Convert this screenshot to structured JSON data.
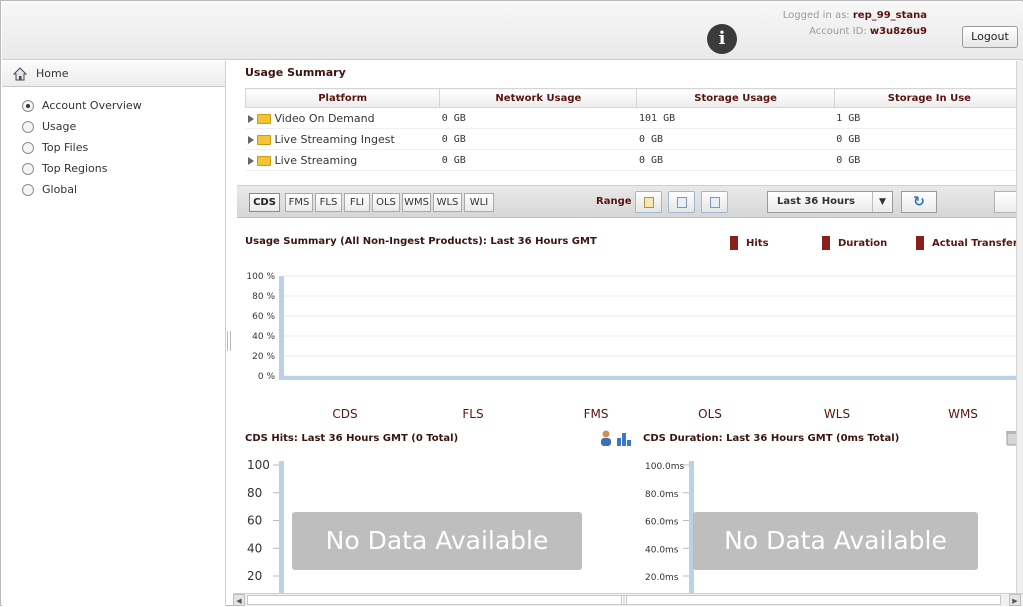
{
  "header": {
    "logged_in_prefix": "Logged in as:",
    "username": "rep_99_stana",
    "account_prefix": "Account ID:",
    "account_id": "w3u8z6u9",
    "logout_label": "Logout"
  },
  "sidebar": {
    "home_label": "Home",
    "items": [
      {
        "label": "Account Overview",
        "selected": true
      },
      {
        "label": "Usage",
        "selected": false
      },
      {
        "label": "Top Files",
        "selected": false
      },
      {
        "label": "Top Regions",
        "selected": false
      },
      {
        "label": "Global",
        "selected": false
      }
    ]
  },
  "usage_summary": {
    "title": "Usage Summary",
    "columns": [
      "Platform",
      "Network Usage",
      "Storage Usage",
      "Storage In Use"
    ],
    "rows": [
      [
        "Video On Demand",
        "0 GB",
        "101 GB",
        "1 GB"
      ],
      [
        "Live Streaming Ingest",
        "0 GB",
        "0 GB",
        "0 GB"
      ],
      [
        "Live Streaming",
        "0 GB",
        "0 GB",
        "0 GB"
      ]
    ]
  },
  "toolbar": {
    "product_tabs": [
      "CDS",
      "FMS",
      "FLS",
      "FLI",
      "OLS",
      "WMS",
      "WLS",
      "WLI"
    ],
    "selected_tab": "CDS",
    "range_label": "Range",
    "range_value": "Last 36 Hours"
  },
  "summary_chart": {
    "title": "Usage Summary (All Non-Ingest Products): Last 36 Hours GMT",
    "legend": [
      "Hits",
      "Duration",
      "Actual Transfer"
    ],
    "legend_color": "#8a1f1b"
  },
  "hits_chart": {
    "title": "CDS Hits: Last 36 Hours GMT (0 Total)",
    "no_data": "No Data Available"
  },
  "duration_chart": {
    "title": "CDS Duration: Last 36 Hours GMT (0ms Total)",
    "no_data": "No Data Available"
  },
  "chart_data": [
    {
      "type": "bar",
      "title": "Usage Summary (All Non-Ingest Products): Last 36 Hours GMT",
      "categories": [
        "CDS",
        "FLS",
        "FMS",
        "OLS",
        "WLS",
        "WMS"
      ],
      "series": [
        {
          "name": "Hits",
          "values": [
            0,
            0,
            0,
            0,
            0,
            0
          ]
        },
        {
          "name": "Duration",
          "values": [
            0,
            0,
            0,
            0,
            0,
            0
          ]
        },
        {
          "name": "Actual Transfer",
          "values": [
            0,
            0,
            0,
            0,
            0,
            0
          ]
        }
      ],
      "yticks": [
        "0 %",
        "20 %",
        "40 %",
        "60 %",
        "80 %",
        "100 %"
      ],
      "ylim": [
        0,
        100
      ],
      "grid": true,
      "legend_position": "top-right"
    },
    {
      "type": "bar",
      "title": "CDS Hits: Last 36 Hours GMT (0 Total)",
      "yticks": [
        "20",
        "40",
        "60",
        "80",
        "100"
      ],
      "ylim": [
        0,
        100
      ],
      "values": []
    },
    {
      "type": "bar",
      "title": "CDS Duration: Last 36 Hours GMT (0ms Total)",
      "yticks": [
        "20.0ms",
        "40.0ms",
        "60.0ms",
        "80.0ms",
        "100.0ms"
      ],
      "ylim": [
        0,
        100
      ],
      "values": []
    }
  ],
  "colors": {
    "heading": "#3a1413",
    "accent": "#5a1412",
    "bar_base": "#bcd0e8"
  },
  "icons": [
    "info-icon",
    "home-icon",
    "folder-icon",
    "calendar-icon",
    "refresh-icon",
    "export-icon",
    "user-icon",
    "bar-chart-icon",
    "trash-icon"
  ]
}
